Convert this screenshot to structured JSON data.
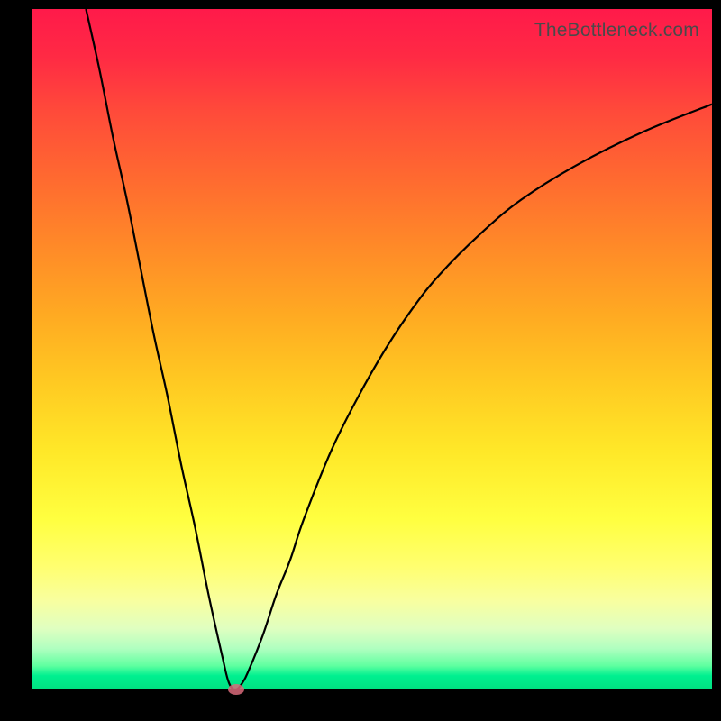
{
  "watermark": "TheBottleneck.com",
  "chart_data": {
    "type": "line",
    "title": "",
    "xlabel": "",
    "ylabel": "",
    "x_range": [
      0,
      100
    ],
    "y_range": [
      0,
      100
    ],
    "grid": false,
    "series": [
      {
        "name": "bottleneck-curve",
        "x": [
          8,
          10,
          12,
          14,
          16,
          18,
          20,
          22,
          24,
          26,
          28,
          29,
          30,
          31,
          32,
          34,
          36,
          38,
          40,
          44,
          48,
          52,
          56,
          60,
          66,
          72,
          80,
          90,
          100
        ],
        "y": [
          100,
          91,
          81,
          72,
          62,
          52,
          43,
          33,
          24,
          14,
          5,
          1,
          0,
          1,
          3,
          8,
          14,
          19,
          25,
          35,
          43,
          50,
          56,
          61,
          67,
          72,
          77,
          82,
          86
        ],
        "color": "#000000"
      }
    ],
    "marker": {
      "x": 30,
      "y": 0,
      "color": "#d96a7a"
    },
    "gradient_background": {
      "top": "#ff1a4a",
      "middle": "#ffe828",
      "bottom": "#00e080"
    }
  }
}
